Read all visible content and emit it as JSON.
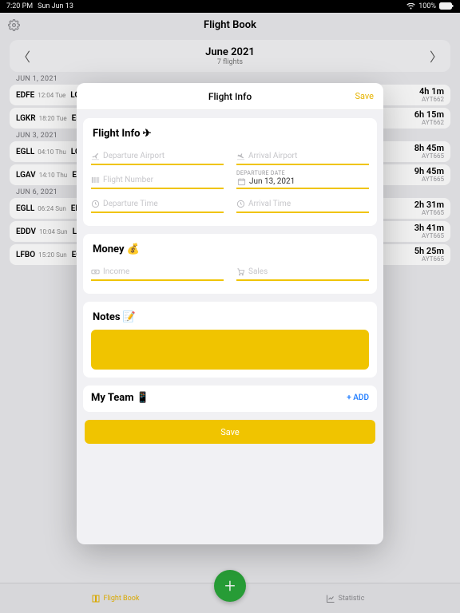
{
  "status": {
    "time": "7:20 PM",
    "date": "Sun Jun 13",
    "wifi": "􀙇",
    "battery": "100%"
  },
  "header": {
    "title": "Flight Book"
  },
  "month": {
    "label": "June 2021",
    "sub": "7 flights"
  },
  "dates": [
    "JUN 1, 2021",
    "JUN 3, 2021",
    "JUN 6, 2021"
  ],
  "rows": [
    {
      "c1": "EDFE",
      "t1": "12:04",
      "d1": "Tue",
      "c2": "LGKR",
      "dur": "4h 1m",
      "ref": "AYT662"
    },
    {
      "c1": "LGKR",
      "t1": "18:20",
      "d1": "Tue",
      "c2": "EDFE",
      "dur": "6h 15m",
      "ref": "AYT662"
    },
    {
      "c1": "EGLL",
      "t1": "04:10",
      "d1": "Thu",
      "c2": "LGAV",
      "dur": "8h 45m",
      "ref": "AYT665"
    },
    {
      "c1": "LGAV",
      "t1": "14:10",
      "d1": "Thu",
      "c2": "EGLL",
      "dur": "9h 45m",
      "ref": "AYT665"
    },
    {
      "c1": "EGLL",
      "t1": "06:24",
      "d1": "Sun",
      "c2": "EDDV",
      "dur": "2h 31m",
      "ref": "AYT665"
    },
    {
      "c1": "EDDV",
      "t1": "10:04",
      "d1": "Sun",
      "c2": "LFBO",
      "dur": "3h 41m",
      "ref": "AYT665"
    },
    {
      "c1": "LFBO",
      "t1": "15:20",
      "d1": "Sun",
      "c2": "EGLL",
      "dur": "5h 25m",
      "ref": "AYT665"
    }
  ],
  "modal": {
    "title": "Flight Info",
    "save": "Save",
    "flightInfo": {
      "heading": "Flight Info ✈︎",
      "dep_ph": "Departure Airport",
      "arr_ph": "Arrival Airport",
      "num_ph": "Flight Number",
      "depdate_lbl": "DEPARTURE DATE",
      "depdate_val": "Jun 13, 2021",
      "deptime_ph": "Departure Time",
      "arrtime_ph": "Arrival Time"
    },
    "money": {
      "heading": "Money 💰",
      "income_ph": "Income",
      "sales_ph": "Sales"
    },
    "notes": {
      "heading": "Notes 📝"
    },
    "team": {
      "heading": "My Team 📱",
      "add": "+ ADD"
    },
    "savebtn": "Save"
  },
  "tabs": {
    "flight": "Flight Book",
    "stat": "Statistic"
  }
}
